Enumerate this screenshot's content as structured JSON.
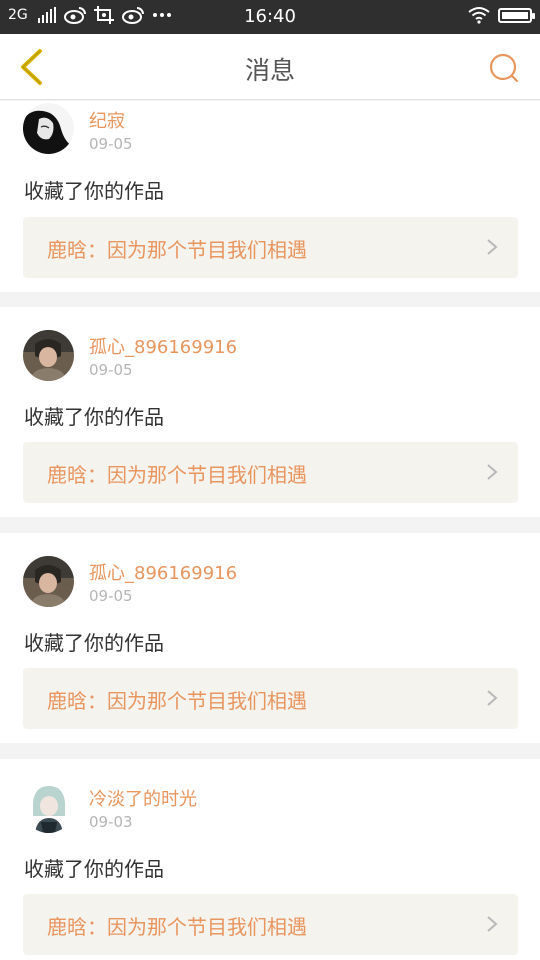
{
  "status_bar": {
    "network": "2G",
    "time": "16:40",
    "icons": [
      "signal-icon",
      "weibo-icon",
      "screenshot-icon",
      "weibo-icon",
      "more-icon",
      "wifi-icon",
      "battery-icon"
    ]
  },
  "header": {
    "title": "消息",
    "back_icon": "chevron-left-icon",
    "search_icon": "search-icon",
    "accent_color": "#e8955e",
    "back_color": "#d9b400"
  },
  "messages": [
    {
      "username": "纪寂",
      "date": "09-05",
      "action": "收藏了你的作品",
      "work_title": "鹿晗：因为那个节目我们相遇"
    },
    {
      "username": "孤心_896169916",
      "date": "09-05",
      "action": "收藏了你的作品",
      "work_title": "鹿晗：因为那个节目我们相遇"
    },
    {
      "username": "孤心_896169916",
      "date": "09-05",
      "action": "收藏了你的作品",
      "work_title": "鹿晗：因为那个节目我们相遇"
    },
    {
      "username": "冷淡了的时光",
      "date": "09-03",
      "action": "收藏了你的作品",
      "work_title": "鹿晗：因为那个节目我们相遇"
    }
  ]
}
